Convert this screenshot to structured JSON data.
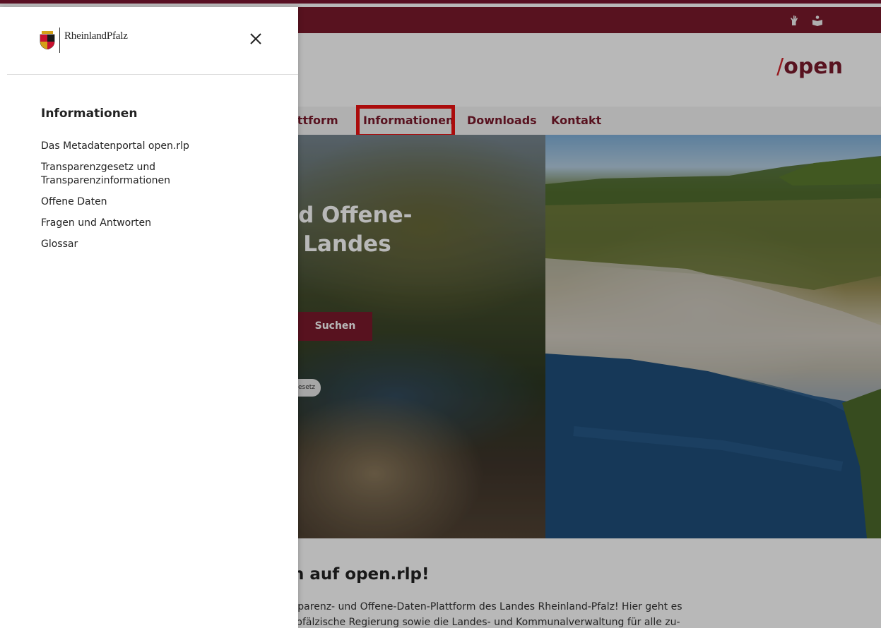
{
  "colors": {
    "brand": "#7a1a2c",
    "brand_slash": "#d2232a",
    "highlight_box": "#ee1111"
  },
  "utility_bar": {
    "icons": [
      "sign-language-icon",
      "easy-reading-icon"
    ]
  },
  "header": {
    "brand_slash": "/",
    "brand_text": "open"
  },
  "nav": {
    "items": [
      {
        "label": "attform"
      },
      {
        "label": "Informationen"
      },
      {
        "label": "Downloads"
      },
      {
        "label": "Kontakt"
      }
    ]
  },
  "hero": {
    "title": "nd Offene-\ns Landes",
    "search_button": "Suchen",
    "tag": "esetz"
  },
  "intro": {
    "heading": "n auf open.rlp!",
    "text": "sparenz- und Offene-Daten-Plattform des Landes Rheinland-Pfalz! Hier geht es\n-pfälzische Regierung sowie die Landes- und Kommunalverwaltung für alle zu-"
  },
  "drawer": {
    "logo_text": "RheinlandPfalz",
    "title": "Informationen",
    "links": [
      {
        "label": "Das Metadatenportal open.rlp"
      },
      {
        "label": "Transparenzgesetz und\nTransparenzinformationen"
      },
      {
        "label": "Offene Daten"
      },
      {
        "label": "Fragen und Antworten"
      },
      {
        "label": "Glossar"
      }
    ]
  }
}
